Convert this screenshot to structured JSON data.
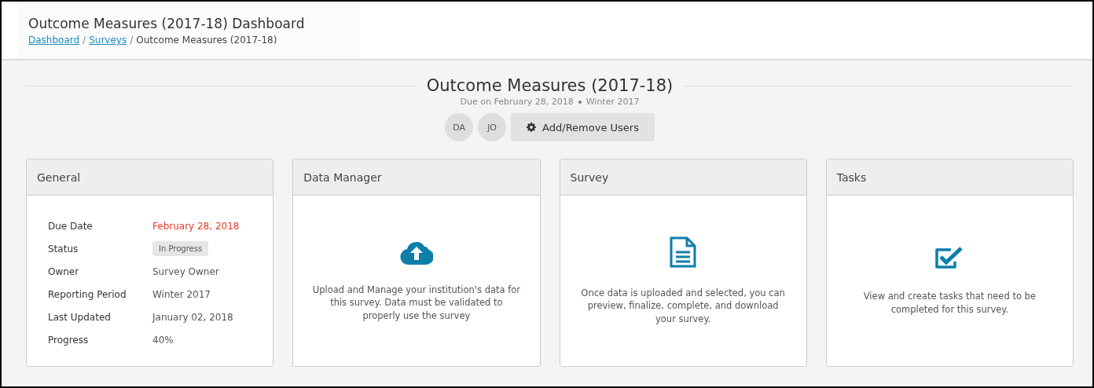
{
  "header": {
    "title": "Outcome Measures (2017-18) Dashboard",
    "separator": "/",
    "breadcrumb": [
      {
        "label": "Dashboard",
        "kind": "link"
      },
      {
        "label": "Surveys",
        "kind": "link"
      },
      {
        "label": "Outcome Measures (2017-18)",
        "kind": "text"
      }
    ]
  },
  "survey": {
    "title": "Outcome Measures (2017-18)",
    "due": "Due on February 28, 2018",
    "period": "Winter 2017",
    "users": [
      "DA",
      "JO"
    ],
    "manage_button": "Add/Remove Users"
  },
  "cards": [
    {
      "title": "General",
      "kind": "details",
      "rows": [
        {
          "label": "Due Date",
          "value": "February 28, 2018",
          "kind": "alert"
        },
        {
          "label": "Status",
          "value": "In Progress",
          "kind": "badge"
        },
        {
          "label": "Owner",
          "value": "Survey Owner",
          "kind": "text"
        },
        {
          "label": "Reporting Period",
          "value": "Winter 2017",
          "kind": "text"
        },
        {
          "label": "Last Updated",
          "value": "January 02, 2018",
          "kind": "text"
        },
        {
          "label": "Progress",
          "value": "40%",
          "kind": "text"
        }
      ]
    },
    {
      "title": "Data Manager",
      "kind": "upload",
      "text": "Upload and Manage your institution's data for this survey. Data must be validated to properly use the survey"
    },
    {
      "title": "Survey",
      "kind": "document",
      "text": "Once data is uploaded and selected, you can preview, finalize, complete, and download your survey."
    },
    {
      "title": "Tasks",
      "kind": "tasks",
      "text": "View and create tasks that need to be completed for this survey."
    }
  ]
}
